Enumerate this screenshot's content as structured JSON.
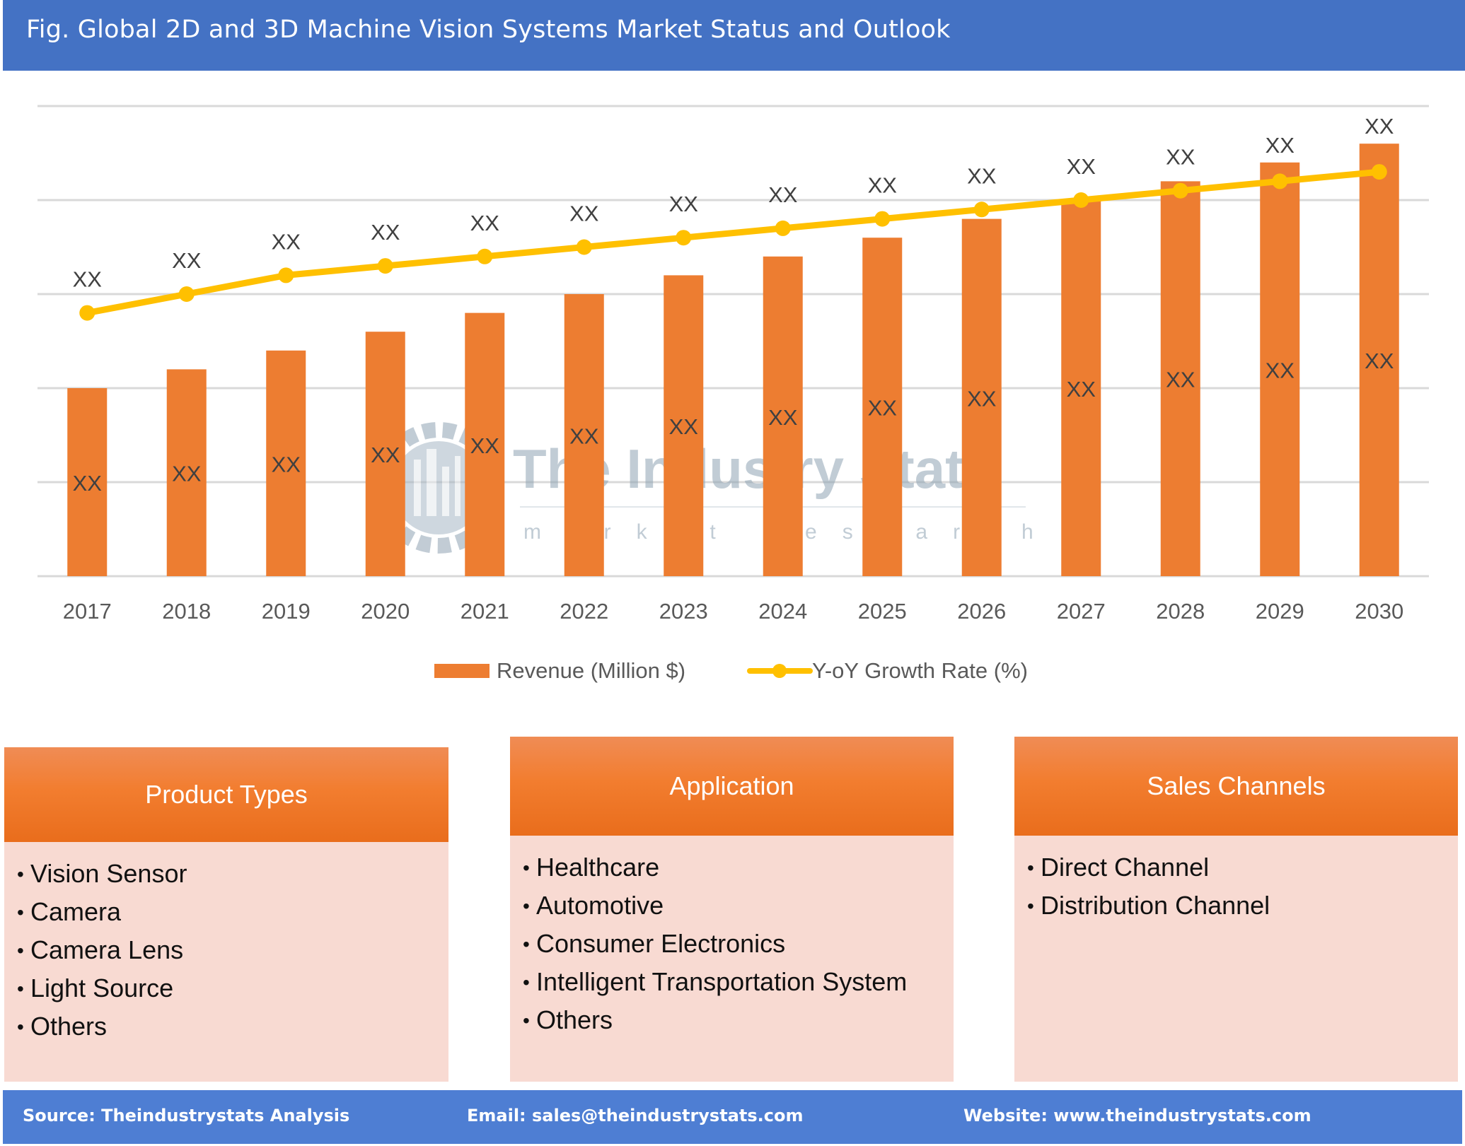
{
  "header": {
    "title": "Fig. Global 2D and 3D Machine Vision Systems Market Status and Outlook"
  },
  "colors": {
    "header_bg": "#4472C4",
    "bar": "#ED7D31",
    "line": "#FFC000",
    "panel_header": "#F27D2F",
    "panel_body": "#F8DAD2",
    "footer_bg": "#4E7ED3"
  },
  "watermark": {
    "name": "The Industry Stats",
    "tagline": "market research"
  },
  "chart_data": {
    "type": "bar",
    "title": "",
    "xlabel": "",
    "ylabel": "",
    "ylim": [
      0,
      100
    ],
    "grid": true,
    "gridline_count": 6,
    "categories": [
      "2017",
      "2018",
      "2019",
      "2020",
      "2021",
      "2022",
      "2023",
      "2024",
      "2025",
      "2026",
      "2027",
      "2028",
      "2029",
      "2030"
    ],
    "series": [
      {
        "name": "Revenue (Million $)",
        "type": "bar",
        "values": [
          40,
          44,
          48,
          52,
          56,
          60,
          64,
          68,
          72,
          76,
          80,
          84,
          88,
          92
        ],
        "labels": [
          "XX",
          "XX",
          "XX",
          "XX",
          "XX",
          "XX",
          "XX",
          "XX",
          "XX",
          "XX",
          "XX",
          "XX",
          "XX",
          "XX"
        ]
      },
      {
        "name": "Y-oY Growth Rate (%)",
        "type": "line",
        "values": [
          56,
          60,
          64,
          66,
          68,
          70,
          72,
          74,
          76,
          78,
          80,
          82,
          84,
          86
        ],
        "labels": [
          "XX",
          "XX",
          "XX",
          "XX",
          "XX",
          "XX",
          "XX",
          "XX",
          "XX",
          "XX",
          "XX",
          "XX",
          "XX",
          "XX"
        ]
      }
    ],
    "legend": {
      "position": "bottom",
      "entries": [
        "Revenue (Million $)",
        "Y-oY Growth Rate (%)"
      ]
    }
  },
  "panels": [
    {
      "title": "Product Types",
      "items": [
        "Vision Sensor",
        "Camera",
        "Camera Lens",
        "Light Source",
        "Others"
      ]
    },
    {
      "title": "Application",
      "items": [
        "Healthcare",
        "Automotive",
        "Consumer Electronics",
        "Intelligent Transportation System",
        "Others"
      ]
    },
    {
      "title": "Sales Channels",
      "items": [
        "Direct Channel",
        "Distribution Channel"
      ]
    }
  ],
  "footer": {
    "source": "Source: Theindustrystats Analysis",
    "email": "Email: sales@theindustrystats.com",
    "website": "Website: www.theindustrystats.com"
  },
  "bullet_char": "•"
}
